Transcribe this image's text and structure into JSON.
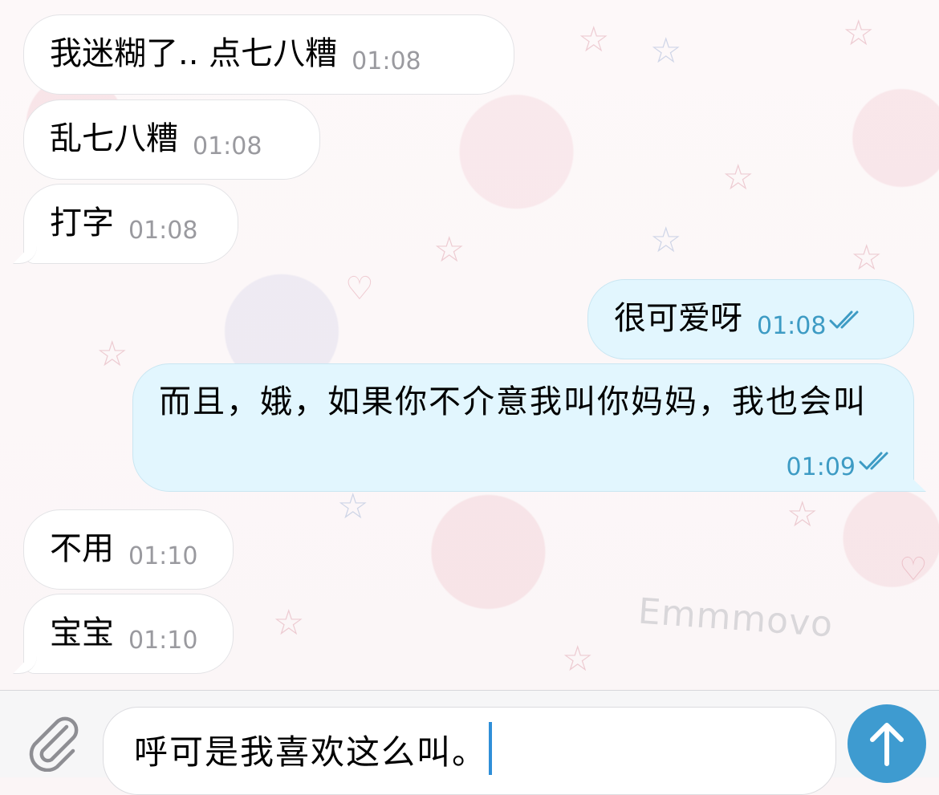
{
  "messages": [
    {
      "direction": "incoming",
      "text": "我迷糊了.. 点七八糟",
      "time": "01:08"
    },
    {
      "direction": "incoming",
      "text": "乱七八糟",
      "time": "01:08"
    },
    {
      "direction": "incoming",
      "text": "打字",
      "time": "01:08"
    },
    {
      "direction": "outgoing",
      "text": "很可爱呀",
      "time": "01:08",
      "status": "read"
    },
    {
      "direction": "outgoing",
      "text": "而且，娥，如果你不介意我叫你妈妈，我也会叫",
      "time": "01:09",
      "status": "read"
    },
    {
      "direction": "incoming",
      "text": "不用",
      "time": "01:10"
    },
    {
      "direction": "incoming",
      "text": "宝宝",
      "time": "01:10"
    }
  ],
  "wallpaper": {
    "watermark": "Emmmovo"
  },
  "composer": {
    "text": "呼可是我喜欢这么叫。",
    "attach_icon": "paperclip-icon",
    "send_icon": "arrow-up-icon"
  },
  "colors": {
    "incoming_bubble": "#ffffff",
    "outgoing_bubble": "#e2f6fe",
    "outgoing_time": "#3d9bc4",
    "incoming_time": "#9a9a9f",
    "send_button": "#3e9bd0",
    "caret": "#2f8fd8"
  }
}
